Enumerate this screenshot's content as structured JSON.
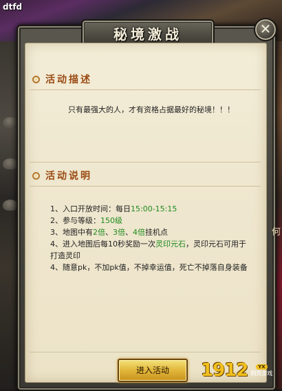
{
  "site_tag": "dtfd",
  "side_glyph": "何",
  "dialog": {
    "title": "秘境激战",
    "close_icon": "close-icon"
  },
  "sections": {
    "intro": {
      "title": "活动描述",
      "text": "只有最强大的人，才有资格占据最好的秘境！！！"
    },
    "rules": {
      "title": "活动说明",
      "items": [
        {
          "prefix": "1、入口开放时间：每日",
          "highlight": "15:00-15:15",
          "suffix": ""
        },
        {
          "prefix": "2、参与等级：",
          "highlight": "150级",
          "suffix": ""
        },
        {
          "prefix": "3、地图中有",
          "highlight": "2倍",
          "mid1": "、",
          "highlight2": "3倍",
          "mid2": "、",
          "highlight3": "4倍",
          "suffix": "挂机点"
        },
        {
          "prefix": "4、进入地图后每10秒奖励一次",
          "highlight": "灵印元石",
          "suffix": "，灵印元石可用于打造灵印"
        },
        {
          "prefix": "4、随意pk，不加pk值，不掉幸运值，死亡不掉落自身装备",
          "highlight": "",
          "suffix": ""
        }
      ]
    }
  },
  "buttons": {
    "enter": "进入活动"
  },
  "watermark": {
    "number": "1912",
    "badge": "YX",
    "caption": "网页游戏"
  },
  "colors": {
    "highlight_green": "#1e8a1e",
    "section_title": "#9a4a12",
    "button_gold": "#e1b63a"
  }
}
